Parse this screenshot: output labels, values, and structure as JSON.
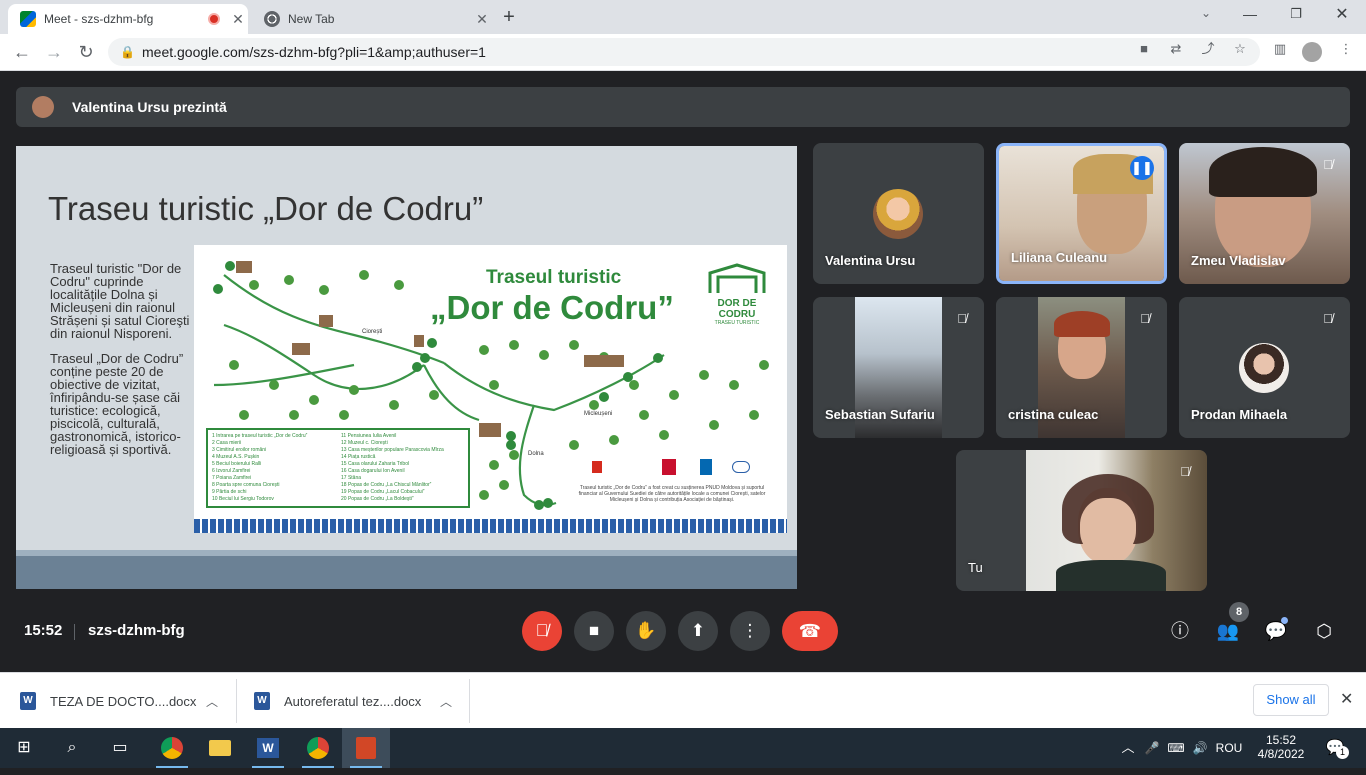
{
  "browser": {
    "tabs": [
      {
        "title": "Meet - szs-dzhm-bfg",
        "active": true,
        "recording": true
      },
      {
        "title": "New Tab",
        "active": false
      }
    ],
    "new_tab_label": "+",
    "url": "meet.google.com/szs-dzhm-bfg?pli=1&amp;authuser=1"
  },
  "meet": {
    "presenting_banner": "Valentina Ursu prezintă",
    "slide": {
      "title": "Traseu turistic „Dor de Codru”",
      "para1": "Traseul turistic \"Dor de Codru\" cuprinde localitățile Dolna și Micleușeni din raionul Strășeni și satul Cioreşti din raionul Nisporeni.",
      "para2": "Traseul „Dor de Codru” conține peste 20 de obiective de vizitat, înfiripându-se șase căi turistice: ecologică, piscicolă, culturală, gastronomică, istorico-religioasă și sportivă.",
      "map": {
        "title_line1": "Traseul turistic",
        "title_line2": "„Dor de Codru”",
        "logo_text": "DOR DE CODRU",
        "logo_sub": "TRASEU TURISTIC",
        "places": [
          "Ciorești",
          "Micleușeni",
          "Dolna"
        ],
        "legend": [
          "1 Intrarea pe traseul turistic „Dor de Codru”",
          "2 Casa mierii",
          "3 Cimitirul eroilor români",
          "4 Muzeul A.S. Pușkin",
          "5 Beciul boierului Ralli",
          "6 Izvorul Zamfirei",
          "7 Poiana Zamfirei",
          "8 Poarta spre comuna Ciorești",
          "9 Pârtia de schi",
          "10 Beciul lui Sergiu Todorov",
          "11 Pensiunea Iulia Avenil",
          "12 Muzeul c. Ciorești",
          "13 Casa meșterilor populare Parascovia Mîrza",
          "14 Piața rustică",
          "15 Casa olarului Zaharia Tribol",
          "16 Casa dogarului Ion Avenil",
          "17 Stâna",
          "18 Popas de Codru „La Chiscul Mânlitor”",
          "19 Popas de Codru „Lacul Cobacului”",
          "20 Popas de Codru „La Boldeşti”"
        ],
        "credit": "Traseul turistic „Dor de Codru” a fost creat cu susținerea PNUD Moldova și suportul financiar al Guvernului Suediei de către autoritățile locale a comunei Ciorești, satelor Micleușeni și Dolna și contribuția Asociației de băștinași."
      }
    },
    "participants": [
      {
        "name": "Valentina Ursu",
        "muted": false,
        "speaking": false
      },
      {
        "name": "Liliana Culeanu",
        "muted": false,
        "speaking": true
      },
      {
        "name": "Zmeu Vladislav",
        "muted": true
      },
      {
        "name": "Sebastian Sufariu",
        "muted": true
      },
      {
        "name": "cristina culeac",
        "muted": true
      },
      {
        "name": "Prodan Mihaela",
        "muted": true
      },
      {
        "name": "Tu",
        "muted": true
      }
    ],
    "time": "15:52",
    "meeting_code": "szs-dzhm-bfg",
    "participant_count": "8",
    "colors": {
      "accent_blue": "#8ab4f8",
      "leave_red": "#ea4335",
      "speaking_border": "#8ab4f8"
    }
  },
  "downloads": {
    "items": [
      {
        "name": "TEZA DE DOCTO....docx",
        "icon": "word-icon"
      },
      {
        "name": "Autoreferatul tez....docx",
        "icon": "word-icon"
      }
    ],
    "show_all": "Show all"
  },
  "taskbar": {
    "language": "ROU",
    "clock_time": "15:52",
    "clock_date": "4/8/2022",
    "notification_count": "1"
  }
}
